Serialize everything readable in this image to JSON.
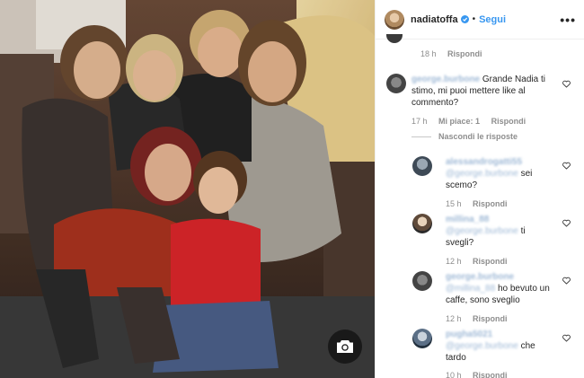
{
  "header": {
    "username": "nadiatoffa",
    "separator": "•",
    "follow_label": "Segui",
    "more_label": "•••"
  },
  "top_partial": {
    "time": "18 h",
    "reply": "Rispondi"
  },
  "main_comment": {
    "username": "george.burbone",
    "text": "Grande Nadia ti stimo, mi puoi mettere like al commento?",
    "time": "17 h",
    "likes": "Mi piace: 1",
    "reply": "Rispondi",
    "hide_replies": "Nascondi le risposte"
  },
  "replies": [
    {
      "username": "alessandrogatti55",
      "mention": "@george.burbone",
      "text": "sei scemo?",
      "time": "15 h",
      "reply": "Rispondi"
    },
    {
      "username": "millina_88",
      "mention": "@george.burbone",
      "text": "ti svegli?",
      "time": "12 h",
      "reply": "Rispondi"
    },
    {
      "username": "george.burbone",
      "mention": "@millina_88",
      "text": "ho bevuto un caffe, sono sveglio",
      "time": "12 h",
      "reply": "Rispondi"
    },
    {
      "username": "pugha5021",
      "mention": "@george.burbone",
      "text": "che tardo",
      "time": "10 h",
      "reply": "Rispondi"
    }
  ],
  "colors": {
    "link": "#3897f0",
    "muted": "#8e8e8e",
    "text": "#262626"
  }
}
